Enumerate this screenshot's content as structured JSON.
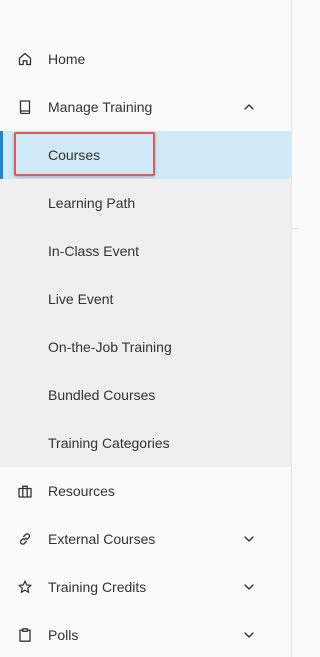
{
  "nav": {
    "home": {
      "label": "Home",
      "icon": "home-icon"
    },
    "manage_training": {
      "label": "Manage Training",
      "icon": "book-icon",
      "expanded": true,
      "children": [
        {
          "label": "Courses",
          "active": true
        },
        {
          "label": "Learning Path"
        },
        {
          "label": "In-Class Event"
        },
        {
          "label": "Live Event"
        },
        {
          "label": "On-the-Job Training"
        },
        {
          "label": "Bundled Courses"
        },
        {
          "label": "Training Categories"
        }
      ]
    },
    "resources": {
      "label": "Resources",
      "icon": "briefcase-icon"
    },
    "external_courses": {
      "label": "External Courses",
      "icon": "link-icon"
    },
    "training_credits": {
      "label": "Training Credits",
      "icon": "star-icon"
    },
    "polls": {
      "label": "Polls",
      "icon": "clipboard-icon"
    }
  },
  "colors": {
    "active_bg": "#cfe9f7",
    "active_bar": "#1d86c6",
    "submenu_bg": "#efefef",
    "highlight_border": "#e05b5b"
  }
}
